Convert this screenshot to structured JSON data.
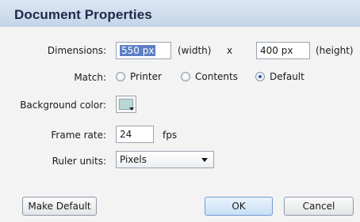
{
  "dialog": {
    "title": "Document Properties"
  },
  "dimensions": {
    "label": "Dimensions:",
    "width_value": "550 px",
    "width_suffix": "(width)",
    "separator": "x",
    "height_value": "400 px",
    "height_suffix": "(height)"
  },
  "match": {
    "label": "Match:",
    "options": [
      {
        "label": "Printer",
        "selected": false
      },
      {
        "label": "Contents",
        "selected": false
      },
      {
        "label": "Default",
        "selected": true
      }
    ]
  },
  "background": {
    "label": "Background color:",
    "color": "#b8d8d8"
  },
  "frame_rate": {
    "label": "Frame rate:",
    "value": "24",
    "unit": "fps"
  },
  "ruler": {
    "label": "Ruler units:",
    "selected": "Pixels"
  },
  "buttons": {
    "make_default": "Make Default",
    "ok": "OK",
    "cancel": "Cancel"
  }
}
